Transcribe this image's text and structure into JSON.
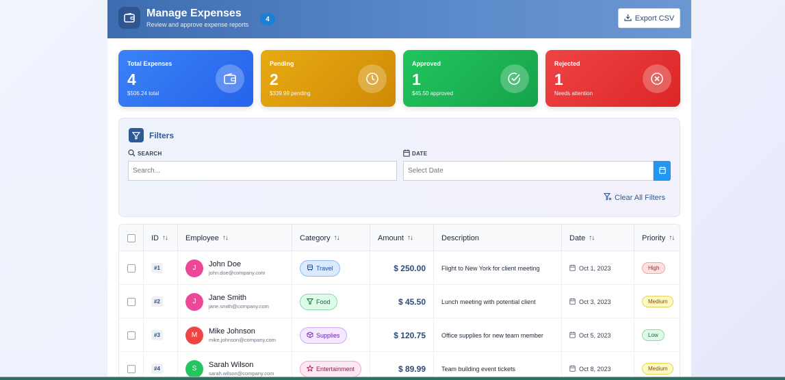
{
  "header": {
    "title": "Manage Expenses",
    "subtitle": "Review and approve expense reports",
    "count_badge": "4",
    "export_label": "Export CSV"
  },
  "stats": {
    "total": {
      "label": "Total Expenses",
      "value": "4",
      "sub": "$506.24 total",
      "icon": "wallet-icon"
    },
    "pending": {
      "label": "Pending",
      "value": "2",
      "sub": "$339.99 pending",
      "icon": "clock-icon"
    },
    "approved": {
      "label": "Approved",
      "value": "1",
      "sub": "$45.50 approved",
      "icon": "check-circle-icon"
    },
    "rejected": {
      "label": "Rejected",
      "value": "1",
      "sub": "Needs attention",
      "icon": "x-circle-icon"
    }
  },
  "filters": {
    "title": "Filters",
    "search_label": "SEARCH",
    "search_placeholder": "Search...",
    "date_label": "DATE",
    "date_placeholder": "Select Date",
    "clear_label": "Clear All Filters"
  },
  "table": {
    "columns": {
      "id": "ID",
      "employee": "Employee",
      "category": "Category",
      "amount": "Amount",
      "description": "Description",
      "date": "Date",
      "priority": "Priority"
    },
    "rows": [
      {
        "id": "#1",
        "initial": "J",
        "avatar_color": "#ec4899",
        "name": "John Doe",
        "email": "john.doe@company.com",
        "category": "Travel",
        "category_icon": "bus-icon",
        "amount": "$ 250.00",
        "description": "Flight to New York for client meeting",
        "date": "Oct 1, 2023",
        "priority": "High"
      },
      {
        "id": "#2",
        "initial": "J",
        "avatar_color": "#ec4899",
        "name": "Jane Smith",
        "email": "jane.smith@company.com",
        "category": "Food",
        "category_icon": "cup-icon",
        "amount": "$ 45.50",
        "description": "Lunch meeting with potential client",
        "date": "Oct 3, 2023",
        "priority": "Medium"
      },
      {
        "id": "#3",
        "initial": "M",
        "avatar_color": "#ef4444",
        "name": "Mike Johnson",
        "email": "mike.johnson@company.com",
        "category": "Supplies",
        "category_icon": "box-icon",
        "amount": "$ 120.75",
        "description": "Office supplies for new team member",
        "date": "Oct 5, 2023",
        "priority": "Low"
      },
      {
        "id": "#4",
        "initial": "S",
        "avatar_color": "#22c55e",
        "name": "Sarah Wilson",
        "email": "sarah.wilson@company.com",
        "category": "Entertainment",
        "category_icon": "star-icon",
        "amount": "$ 89.99",
        "description": "Team building event tickets",
        "date": "Oct 8, 2023",
        "priority": "Medium"
      }
    ]
  },
  "colors": {
    "header": "#4a7bbe",
    "total": "#3b82f6",
    "pending": "#d9970b",
    "approved": "#1fb155",
    "rejected": "#e53535",
    "accent": "#2d5a95"
  }
}
